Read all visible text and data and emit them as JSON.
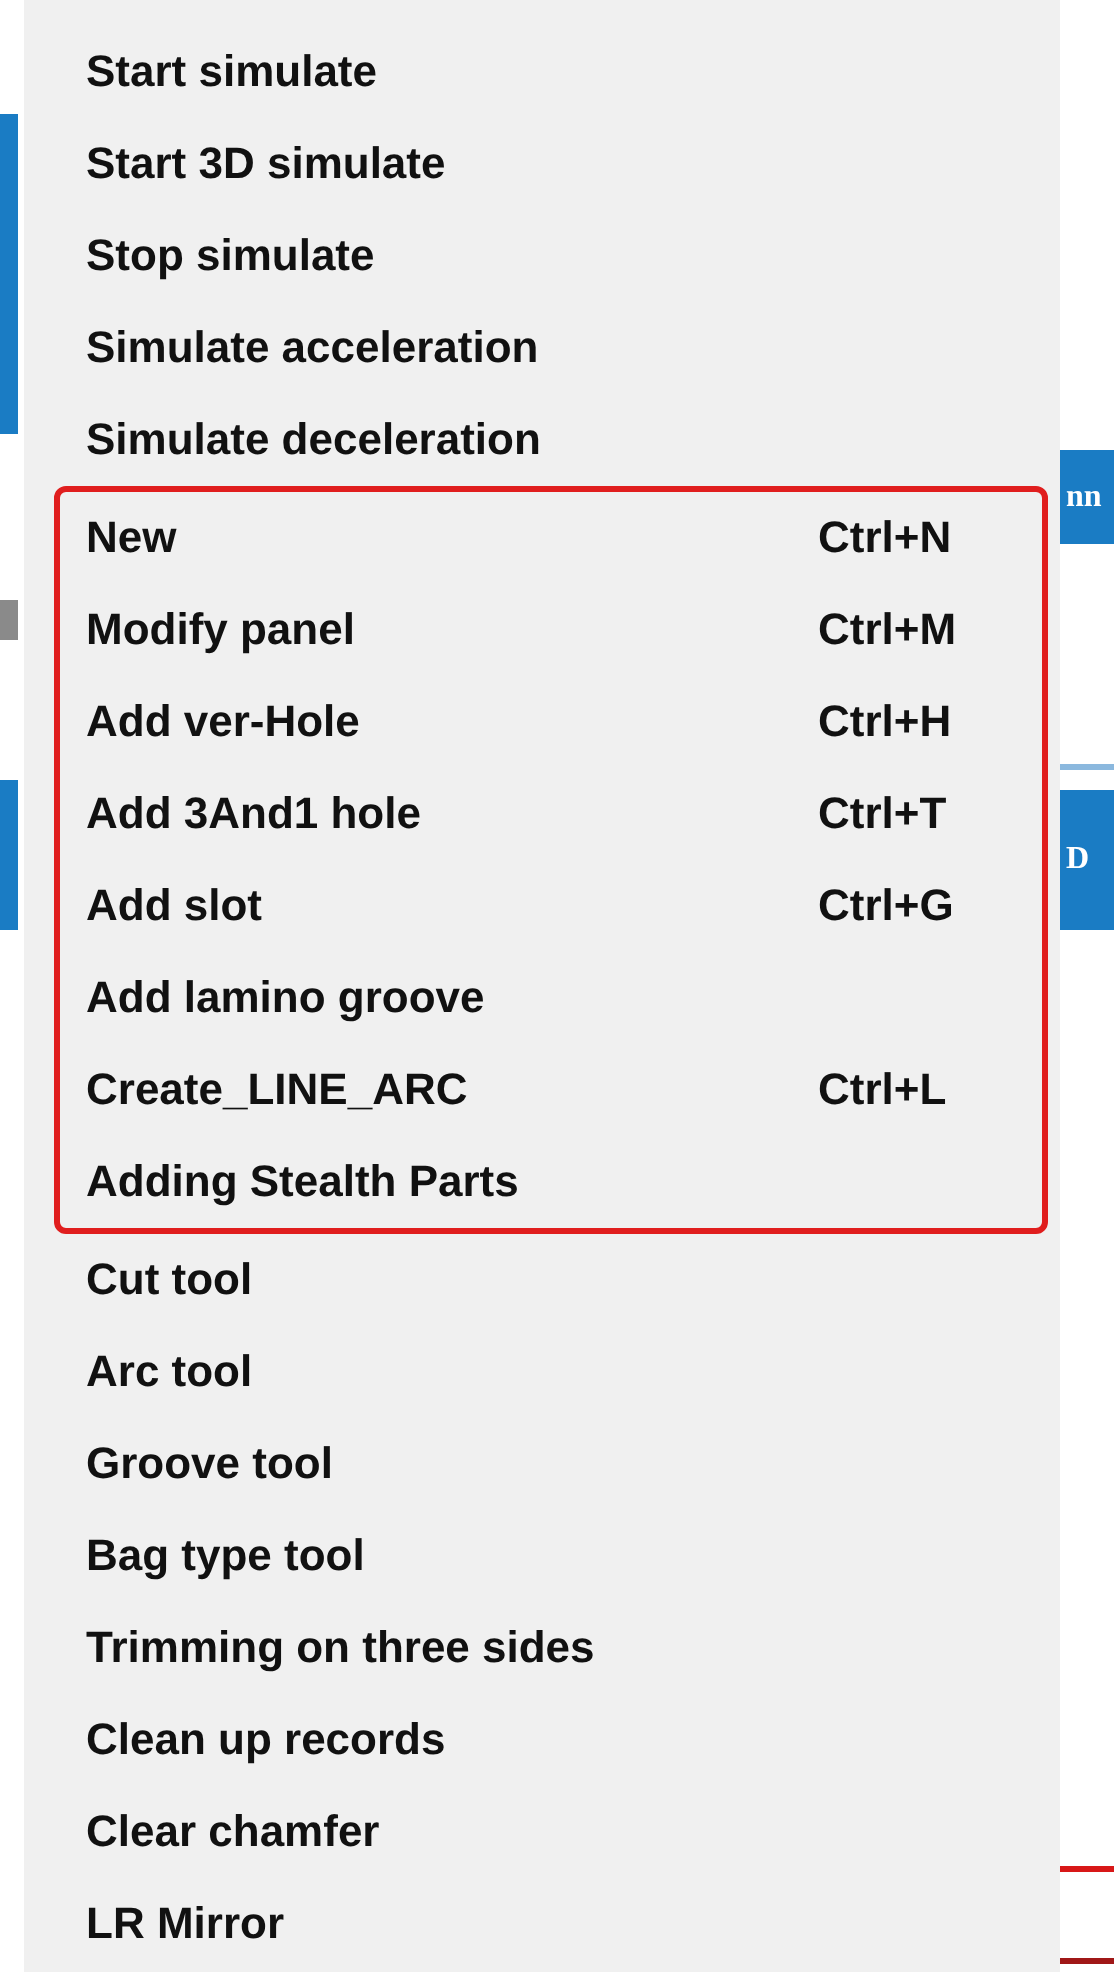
{
  "background": {
    "buttons": [
      {
        "label": "nn"
      },
      {
        "label": "D"
      }
    ]
  },
  "menu": {
    "sections": [
      {
        "highlighted": false,
        "items": [
          {
            "label": "Start simulate"
          },
          {
            "label": "Start 3D simulate"
          },
          {
            "label": "Stop simulate"
          },
          {
            "label": "Simulate acceleration"
          },
          {
            "label": "Simulate deceleration"
          }
        ]
      },
      {
        "highlighted": true,
        "items": [
          {
            "label": "New",
            "shortcut": "Ctrl+N"
          },
          {
            "label": "Modify panel",
            "shortcut": "Ctrl+M"
          },
          {
            "label": "Add ver-Hole",
            "shortcut": "Ctrl+H"
          },
          {
            "label": "Add 3And1 hole",
            "shortcut": "Ctrl+T"
          },
          {
            "label": "Add slot",
            "shortcut": "Ctrl+G"
          },
          {
            "label": "Add lamino groove"
          },
          {
            "label": "Create_LINE_ARC",
            "shortcut": "Ctrl+L"
          },
          {
            "label": "Adding Stealth Parts"
          }
        ]
      },
      {
        "highlighted": false,
        "items": [
          {
            "label": "Cut tool"
          },
          {
            "label": "Arc tool"
          },
          {
            "label": "Groove tool"
          },
          {
            "label": "Bag type tool"
          },
          {
            "label": "Trimming on three sides"
          },
          {
            "label": "Clean up records"
          },
          {
            "label": "Clear chamfer"
          },
          {
            "label": "LR Mirror"
          }
        ]
      }
    ]
  }
}
